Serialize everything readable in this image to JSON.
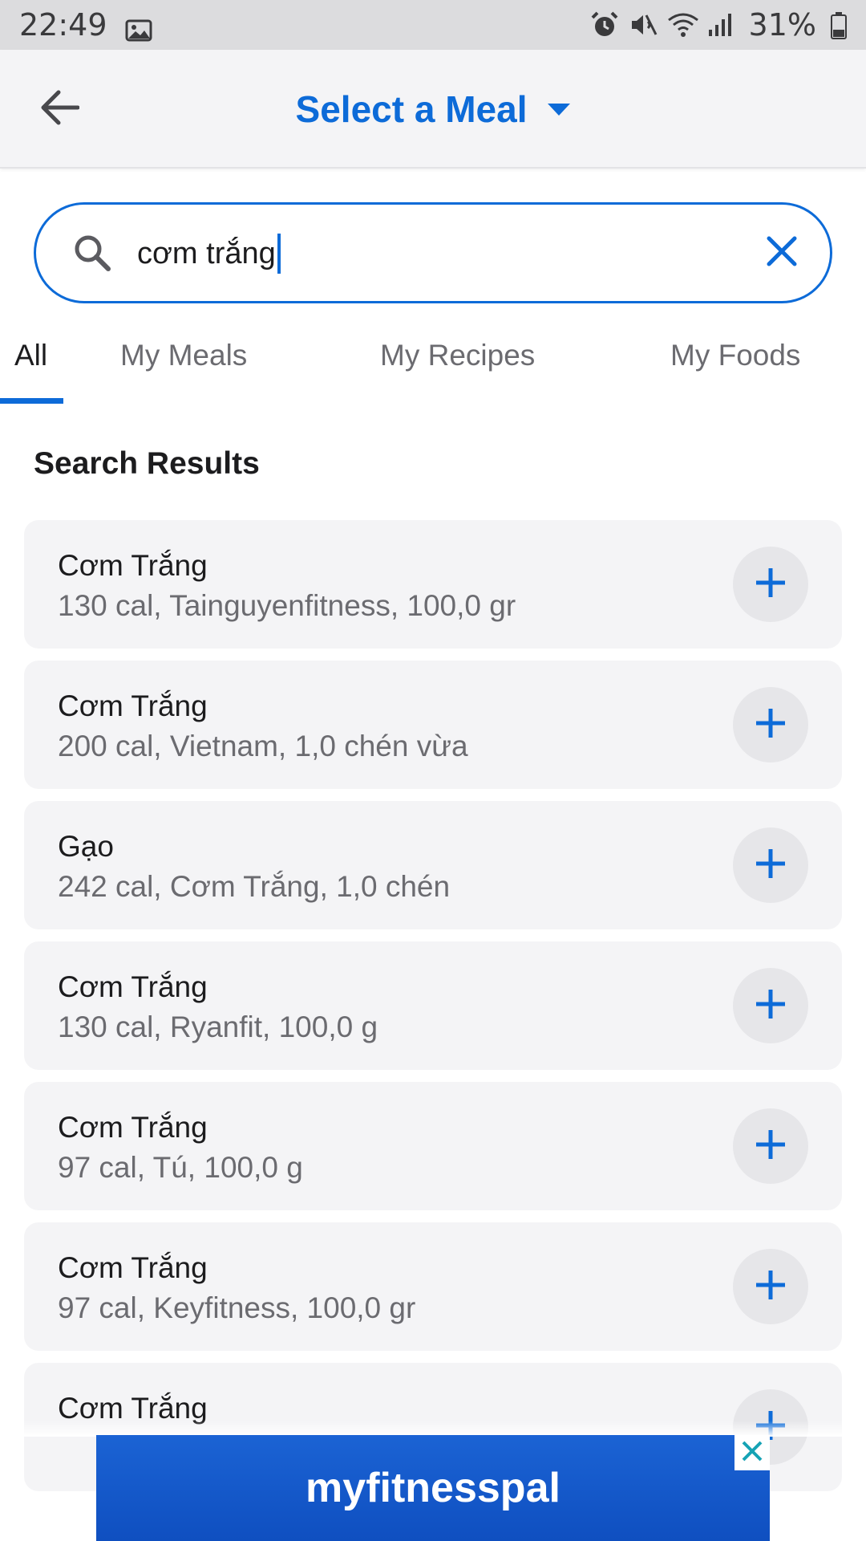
{
  "status_bar": {
    "time": "22:49",
    "battery_percent": "31%",
    "icons": [
      "gallery-icon",
      "alarm-icon",
      "mute-icon",
      "wifi-icon",
      "signal-icon",
      "battery-icon"
    ]
  },
  "header": {
    "title": "Select a Meal",
    "back_icon": "arrow-left-icon",
    "dropdown_icon": "caret-down-icon"
  },
  "search": {
    "value": "cơm trắng",
    "search_icon": "search-icon",
    "clear_icon": "close-icon"
  },
  "tabs": [
    {
      "label": "All",
      "active": true
    },
    {
      "label": "My Meals",
      "active": false
    },
    {
      "label": "My Recipes",
      "active": false
    },
    {
      "label": "My Foods",
      "active": false
    }
  ],
  "results": {
    "title": "Search Results",
    "items": [
      {
        "name": "Cơm Trắng",
        "details": "130 cal, Tainguyenfitness, 100,0 gr"
      },
      {
        "name": "Cơm Trắng",
        "details": "200 cal, Vietnam, 1,0 chén vừa"
      },
      {
        "name": "Gạo",
        "details": "242 cal, Cơm Trắng, 1,0 chén"
      },
      {
        "name": "Cơm Trắng",
        "details": "130 cal, Ryanfit, 100,0 g"
      },
      {
        "name": "Cơm Trắng",
        "details": "97 cal, Tú, 100,0 g"
      },
      {
        "name": "Cơm Trắng",
        "details": "97 cal, Keyfitness, 100,0 gr"
      },
      {
        "name": "Cơm Trắng",
        "details": ""
      }
    ]
  },
  "ad": {
    "brand": "myfitnesspal"
  },
  "colors": {
    "accent": "#0d6bd8",
    "card_bg": "#f4f4f6",
    "muted_text": "#6b6b70"
  }
}
